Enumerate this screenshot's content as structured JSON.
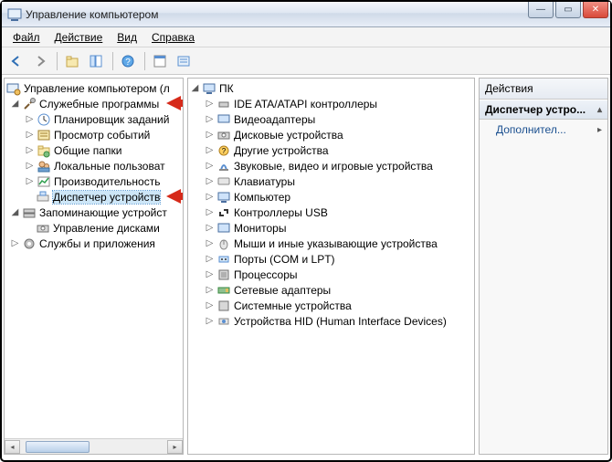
{
  "window": {
    "title": "Управление компьютером",
    "sys": {
      "minimize": "—",
      "maximize": "▭",
      "close": "✕"
    }
  },
  "menu": [
    "Файл",
    "Действие",
    "Вид",
    "Справка"
  ],
  "toolbar_icons": [
    "back",
    "forward",
    "up",
    "frame",
    "help",
    "properties",
    "details"
  ],
  "left_tree": {
    "root": "Управление компьютером (л",
    "system_tools": {
      "label": "Служебные программы",
      "items": [
        "Планировщик заданий",
        "Просмотр событий",
        "Общие папки",
        "Локальные пользоват",
        "Производительность",
        "Диспетчер устройств"
      ]
    },
    "storage": {
      "label": "Запоминающие устройст",
      "items": [
        "Управление дисками"
      ]
    },
    "services": "Службы и приложения"
  },
  "center_tree": {
    "root": "ПК",
    "items": [
      "IDE ATA/ATAPI контроллеры",
      "Видеоадаптеры",
      "Дисковые устройства",
      "Другие устройства",
      "Звуковые, видео и игровые устройства",
      "Клавиатуры",
      "Компьютер",
      "Контроллеры USB",
      "Мониторы",
      "Мыши и иные указывающие устройства",
      "Порты (COM и LPT)",
      "Процессоры",
      "Сетевые адаптеры",
      "Системные устройства",
      "Устройства HID (Human Interface Devices)"
    ]
  },
  "actions": {
    "header": "Действия",
    "section": "Диспетчер устро...",
    "more": "Дополнител..."
  }
}
